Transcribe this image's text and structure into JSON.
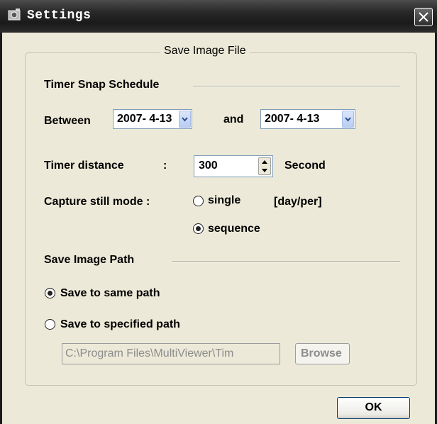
{
  "window": {
    "title": "Settings",
    "close_icon": "close-icon"
  },
  "group": {
    "title": "Save Image File"
  },
  "timer_schedule": {
    "heading": "Timer Snap Schedule",
    "between_label": "Between",
    "start_date": "2007- 4-13",
    "and_label": "and",
    "end_date": "2007- 4-13"
  },
  "timer_distance": {
    "label": "Timer distance",
    "colon": ":",
    "value": "300",
    "unit": "Second"
  },
  "capture_mode": {
    "label": "Capture still mode :",
    "options": [
      {
        "label": "single",
        "checked": false
      },
      {
        "label": "sequence",
        "checked": true
      }
    ],
    "note": "[day/per]"
  },
  "save_path": {
    "heading": "Save Image Path",
    "options": [
      {
        "label": "Save to same path",
        "checked": true
      },
      {
        "label": "Save to specified path",
        "checked": false
      }
    ],
    "path_value": "C:\\Program Files\\MultiViewer\\Tim",
    "browse_label": "Browse"
  },
  "footer": {
    "ok_label": "OK"
  }
}
